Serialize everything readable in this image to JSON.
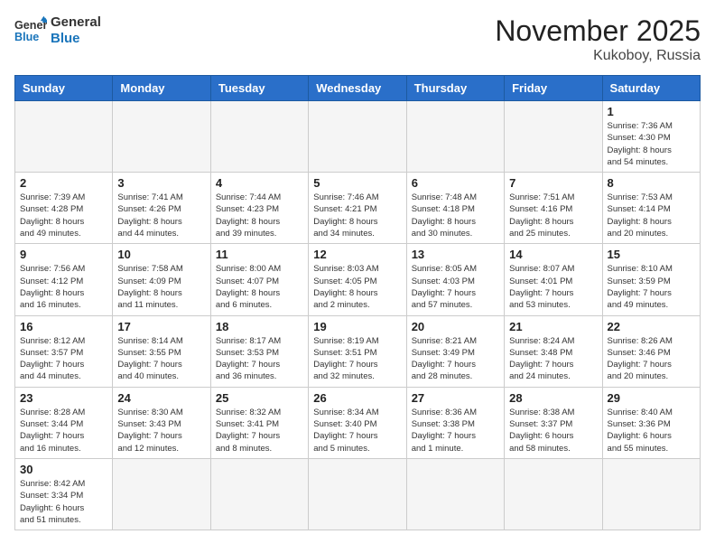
{
  "header": {
    "logo_text_general": "General",
    "logo_text_blue": "Blue",
    "title": "November 2025",
    "subtitle": "Kukoboy, Russia"
  },
  "calendar": {
    "days_of_week": [
      "Sunday",
      "Monday",
      "Tuesday",
      "Wednesday",
      "Thursday",
      "Friday",
      "Saturday"
    ],
    "weeks": [
      [
        {
          "day": "",
          "info": ""
        },
        {
          "day": "",
          "info": ""
        },
        {
          "day": "",
          "info": ""
        },
        {
          "day": "",
          "info": ""
        },
        {
          "day": "",
          "info": ""
        },
        {
          "day": "",
          "info": ""
        },
        {
          "day": "1",
          "info": "Sunrise: 7:36 AM\nSunset: 4:30 PM\nDaylight: 8 hours\nand 54 minutes."
        }
      ],
      [
        {
          "day": "2",
          "info": "Sunrise: 7:39 AM\nSunset: 4:28 PM\nDaylight: 8 hours\nand 49 minutes."
        },
        {
          "day": "3",
          "info": "Sunrise: 7:41 AM\nSunset: 4:26 PM\nDaylight: 8 hours\nand 44 minutes."
        },
        {
          "day": "4",
          "info": "Sunrise: 7:44 AM\nSunset: 4:23 PM\nDaylight: 8 hours\nand 39 minutes."
        },
        {
          "day": "5",
          "info": "Sunrise: 7:46 AM\nSunset: 4:21 PM\nDaylight: 8 hours\nand 34 minutes."
        },
        {
          "day": "6",
          "info": "Sunrise: 7:48 AM\nSunset: 4:18 PM\nDaylight: 8 hours\nand 30 minutes."
        },
        {
          "day": "7",
          "info": "Sunrise: 7:51 AM\nSunset: 4:16 PM\nDaylight: 8 hours\nand 25 minutes."
        },
        {
          "day": "8",
          "info": "Sunrise: 7:53 AM\nSunset: 4:14 PM\nDaylight: 8 hours\nand 20 minutes."
        }
      ],
      [
        {
          "day": "9",
          "info": "Sunrise: 7:56 AM\nSunset: 4:12 PM\nDaylight: 8 hours\nand 16 minutes."
        },
        {
          "day": "10",
          "info": "Sunrise: 7:58 AM\nSunset: 4:09 PM\nDaylight: 8 hours\nand 11 minutes."
        },
        {
          "day": "11",
          "info": "Sunrise: 8:00 AM\nSunset: 4:07 PM\nDaylight: 8 hours\nand 6 minutes."
        },
        {
          "day": "12",
          "info": "Sunrise: 8:03 AM\nSunset: 4:05 PM\nDaylight: 8 hours\nand 2 minutes."
        },
        {
          "day": "13",
          "info": "Sunrise: 8:05 AM\nSunset: 4:03 PM\nDaylight: 7 hours\nand 57 minutes."
        },
        {
          "day": "14",
          "info": "Sunrise: 8:07 AM\nSunset: 4:01 PM\nDaylight: 7 hours\nand 53 minutes."
        },
        {
          "day": "15",
          "info": "Sunrise: 8:10 AM\nSunset: 3:59 PM\nDaylight: 7 hours\nand 49 minutes."
        }
      ],
      [
        {
          "day": "16",
          "info": "Sunrise: 8:12 AM\nSunset: 3:57 PM\nDaylight: 7 hours\nand 44 minutes."
        },
        {
          "day": "17",
          "info": "Sunrise: 8:14 AM\nSunset: 3:55 PM\nDaylight: 7 hours\nand 40 minutes."
        },
        {
          "day": "18",
          "info": "Sunrise: 8:17 AM\nSunset: 3:53 PM\nDaylight: 7 hours\nand 36 minutes."
        },
        {
          "day": "19",
          "info": "Sunrise: 8:19 AM\nSunset: 3:51 PM\nDaylight: 7 hours\nand 32 minutes."
        },
        {
          "day": "20",
          "info": "Sunrise: 8:21 AM\nSunset: 3:49 PM\nDaylight: 7 hours\nand 28 minutes."
        },
        {
          "day": "21",
          "info": "Sunrise: 8:24 AM\nSunset: 3:48 PM\nDaylight: 7 hours\nand 24 minutes."
        },
        {
          "day": "22",
          "info": "Sunrise: 8:26 AM\nSunset: 3:46 PM\nDaylight: 7 hours\nand 20 minutes."
        }
      ],
      [
        {
          "day": "23",
          "info": "Sunrise: 8:28 AM\nSunset: 3:44 PM\nDaylight: 7 hours\nand 16 minutes."
        },
        {
          "day": "24",
          "info": "Sunrise: 8:30 AM\nSunset: 3:43 PM\nDaylight: 7 hours\nand 12 minutes."
        },
        {
          "day": "25",
          "info": "Sunrise: 8:32 AM\nSunset: 3:41 PM\nDaylight: 7 hours\nand 8 minutes."
        },
        {
          "day": "26",
          "info": "Sunrise: 8:34 AM\nSunset: 3:40 PM\nDaylight: 7 hours\nand 5 minutes."
        },
        {
          "day": "27",
          "info": "Sunrise: 8:36 AM\nSunset: 3:38 PM\nDaylight: 7 hours\nand 1 minute."
        },
        {
          "day": "28",
          "info": "Sunrise: 8:38 AM\nSunset: 3:37 PM\nDaylight: 6 hours\nand 58 minutes."
        },
        {
          "day": "29",
          "info": "Sunrise: 8:40 AM\nSunset: 3:36 PM\nDaylight: 6 hours\nand 55 minutes."
        }
      ],
      [
        {
          "day": "30",
          "info": "Sunrise: 8:42 AM\nSunset: 3:34 PM\nDaylight: 6 hours\nand 51 minutes."
        },
        {
          "day": "",
          "info": ""
        },
        {
          "day": "",
          "info": ""
        },
        {
          "day": "",
          "info": ""
        },
        {
          "day": "",
          "info": ""
        },
        {
          "day": "",
          "info": ""
        },
        {
          "day": "",
          "info": ""
        }
      ]
    ]
  }
}
